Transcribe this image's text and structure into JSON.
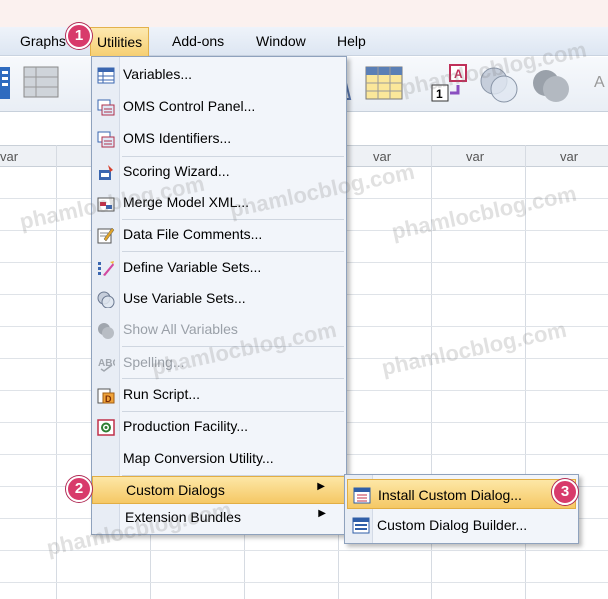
{
  "menubar": {
    "items": [
      {
        "label": "Graphs"
      },
      {
        "label": "Utilities"
      },
      {
        "label": "Add-ons"
      },
      {
        "label": "Window"
      },
      {
        "label": "Help"
      }
    ]
  },
  "grid": {
    "column_headers": [
      "var",
      "var",
      "var",
      "var"
    ]
  },
  "utilities_menu": {
    "items": [
      {
        "label": "Variables...",
        "icon": "variables-icon",
        "enabled": true
      },
      {
        "label": "OMS Control Panel...",
        "icon": "oms-control-icon",
        "enabled": true
      },
      {
        "label": "OMS Identifiers...",
        "icon": "oms-identifiers-icon",
        "enabled": true
      },
      {
        "label": "Scoring Wizard...",
        "icon": "scoring-wizard-icon",
        "enabled": true
      },
      {
        "label": "Merge Model XML...",
        "icon": "merge-xml-icon",
        "enabled": true
      },
      {
        "label": "Data File Comments...",
        "icon": "comments-icon",
        "enabled": true
      },
      {
        "label": "Define Variable Sets...",
        "icon": "define-sets-icon",
        "enabled": true
      },
      {
        "label": "Use Variable Sets...",
        "icon": "use-sets-icon",
        "enabled": true
      },
      {
        "label": "Show All Variables",
        "icon": "show-all-icon",
        "enabled": false
      },
      {
        "label": "Spelling...",
        "icon": "spelling-icon",
        "enabled": false
      },
      {
        "label": "Run Script...",
        "icon": "run-script-icon",
        "enabled": true
      },
      {
        "label": "Production Facility...",
        "icon": "production-icon",
        "enabled": true
      },
      {
        "label": "Map Conversion Utility...",
        "icon": "",
        "enabled": true
      },
      {
        "label": "Custom Dialogs",
        "icon": "",
        "enabled": true,
        "submenu": true
      },
      {
        "label": "Extension Bundles",
        "icon": "",
        "enabled": true,
        "submenu": true
      }
    ]
  },
  "custom_dialogs_submenu": {
    "items": [
      {
        "label": "Install Custom Dialog...",
        "icon": "install-dialog-icon"
      },
      {
        "label": "Custom Dialog Builder...",
        "icon": "dialog-builder-icon"
      }
    ]
  },
  "badges": [
    "1",
    "2",
    "3"
  ],
  "watermark": "phamlocblog.com",
  "colors": {
    "highlight": "#f5c865",
    "badge": "#d83a6b",
    "menu_bg": "#f2f5fa"
  }
}
